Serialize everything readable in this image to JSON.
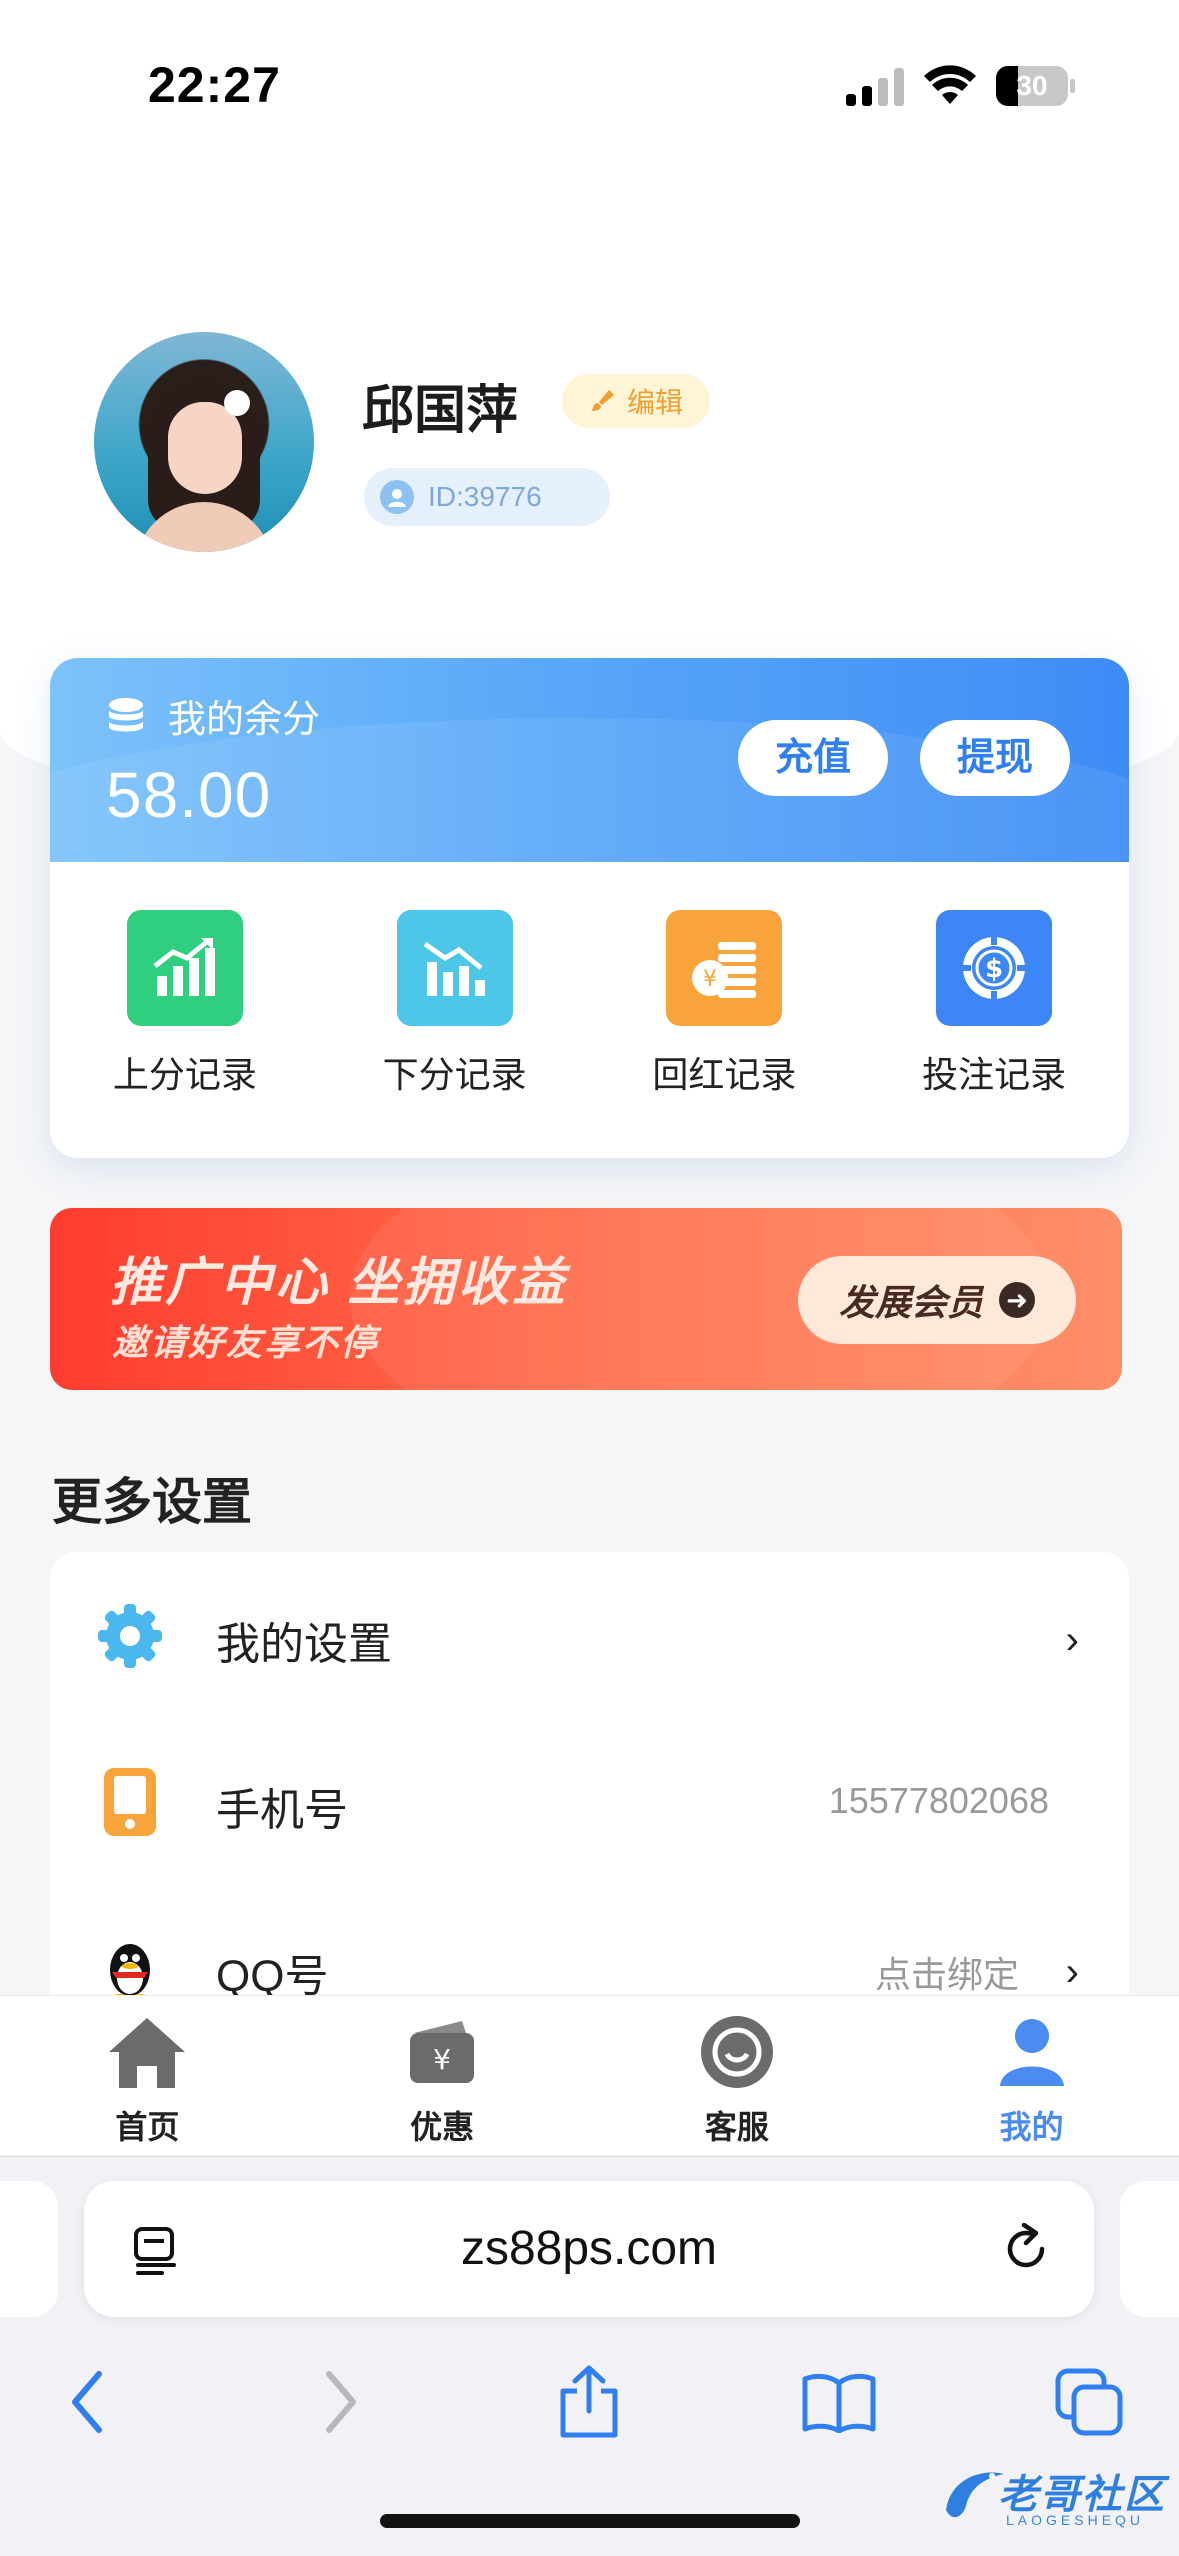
{
  "status_bar": {
    "time": "22:27",
    "battery_level": "30"
  },
  "profile": {
    "name": "邱国萍",
    "edit_label": "编辑",
    "id_label": "ID:39776"
  },
  "wallet": {
    "label": "我的余分",
    "amount": "58.00",
    "recharge_label": "充值",
    "withdraw_label": "提现"
  },
  "records": [
    {
      "label": "上分记录",
      "icon": "chart-up-icon",
      "color": "#2fcf7f"
    },
    {
      "label": "下分记录",
      "icon": "chart-down-icon",
      "color": "#4cc7e8"
    },
    {
      "label": "回红记录",
      "icon": "coin-stack-icon",
      "color": "#f9a43a"
    },
    {
      "label": "投注记录",
      "icon": "chip-icon",
      "color": "#3d86f5"
    }
  ],
  "promo": {
    "title": "推广中心 坐拥收益",
    "subtitle": "邀请好友享不停",
    "button_label": "发展会员"
  },
  "settings": {
    "section_title": "更多设置",
    "items": [
      {
        "label": "我的设置",
        "value": "",
        "icon": "gear-icon"
      },
      {
        "label": "手机号",
        "value": "15577802068",
        "icon": "phone-icon"
      },
      {
        "label": "QQ号",
        "value": "点击绑定",
        "icon": "qq-penguin-icon"
      }
    ]
  },
  "tabbar": [
    {
      "label": "首页",
      "icon": "home-icon",
      "active": false
    },
    {
      "label": "优惠",
      "icon": "wallet-icon",
      "active": false
    },
    {
      "label": "客服",
      "icon": "chat-icon",
      "active": false
    },
    {
      "label": "我的",
      "icon": "user-icon",
      "active": true
    }
  ],
  "browser": {
    "url": "zs88ps.com"
  },
  "watermark": {
    "text": "老哥社区",
    "sub": "LAOGESHEQU"
  },
  "colors": {
    "accent": "#4a8cf0",
    "promo": "#ff5a3c",
    "wallet": "#5aa8f8"
  }
}
